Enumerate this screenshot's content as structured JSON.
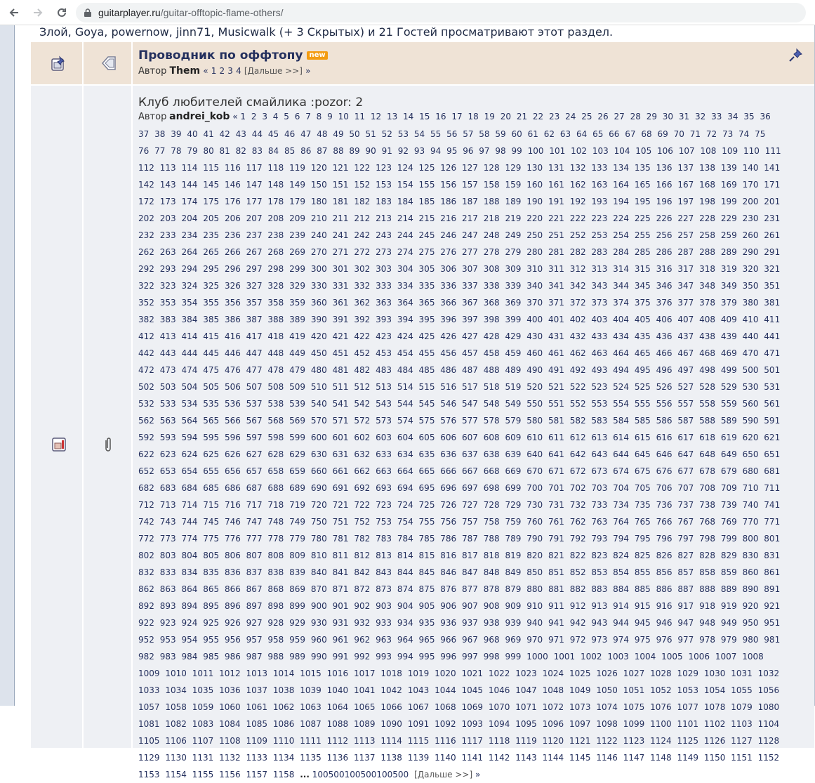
{
  "browser": {
    "url_domain": "guitarplayer.ru",
    "url_path": "/guitar-offtopic-flame-others/"
  },
  "viewers_text": "Злой, Goya, powernow, jinn71, Musicwalk (+ 3 Скрытых) и 21 Гостей просматривают этот раздел.",
  "topics": [
    {
      "title": "Проводник по оффтопу",
      "badge": "new",
      "author_label": "Автор",
      "author": "Them",
      "pager_prefix": "«",
      "pages": [
        "1",
        "2",
        "3",
        "4"
      ],
      "next_label": "[Дальше >>]",
      "pager_suffix": "»"
    },
    {
      "title": "Клуб любителей смайлика :pozor: 2",
      "author_label": "Автор",
      "author": "andrei_kob",
      "pager_prefix": "«",
      "page_count": 1158,
      "ellipsis": "...",
      "last_page": "100500100500100500",
      "next_label": "[Дальше >>]",
      "pager_suffix": "»"
    }
  ],
  "colors": {
    "sticky_row": "#efe3d6",
    "normal_row": "#eef0f4",
    "title_text": "#24305e",
    "badge": "#f39c12"
  },
  "icons": [
    "back-icon",
    "forward-icon",
    "reload-icon",
    "lock-icon",
    "sticky-topic-icon",
    "announcement-icon",
    "pin-icon",
    "hot-topic-icon",
    "attachment-icon"
  ]
}
